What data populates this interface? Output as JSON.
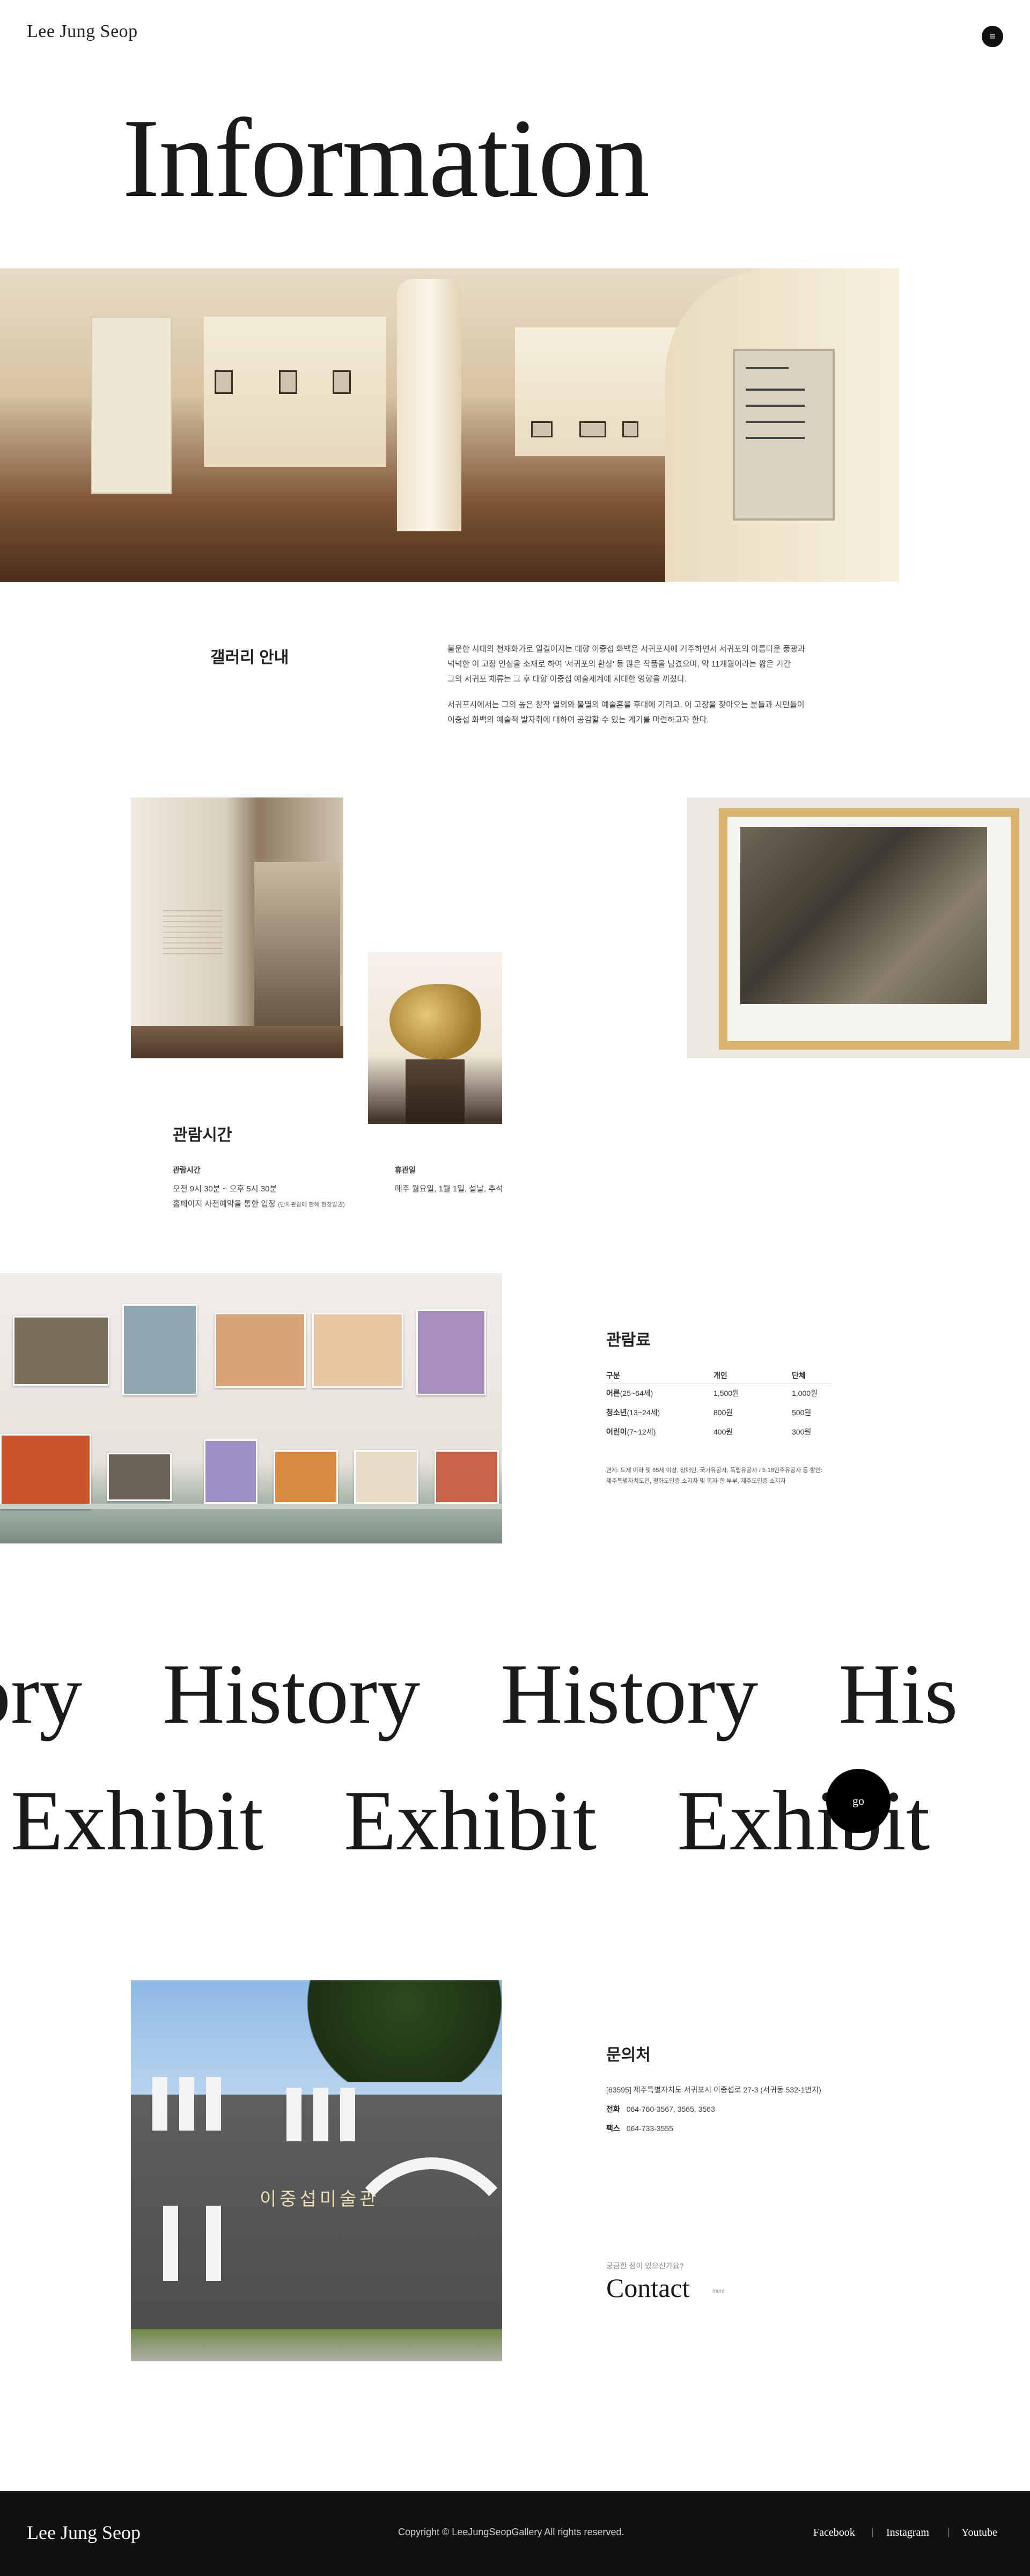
{
  "header": {
    "brand": "Lee Jung Seop",
    "menu_icon": "menu-icon"
  },
  "page": {
    "title": "Information"
  },
  "gallery": {
    "heading": "갤러리 안내",
    "paragraphs": [
      "불운한 시대의 천재화가로 일컬어지는 대향 이중섭 화백은 서귀포시에 거주하면서 서귀포의 아름다운 풍광과",
      "넉넉한 이 고장 인심을 소재로 하여 '서귀포의 환상' 등 많은 작품을 남겼으며, 약 11개월이라는 짧은 기간",
      "그의 서귀포 체류는 그 후 대향 이중섭 예술세계에 지대한 영향을 끼쳤다.",
      "서귀포시에서는 그의 높은 창작 열의와 불멸의 예술혼을 후대에 기리고, 이 고장을 찾아오는 분들과 시민들이",
      "이중섭 화백의 예술적 발자취에 대하여 공감할 수 있는 계기를 마련하고자 한다."
    ]
  },
  "hours": {
    "heading": "관람시간",
    "open_label": "관람시간",
    "open_value": "오전 9시 30분 ~ 오후 5시 30분",
    "reservation": "홈페이지 사전예약을 통한 입장",
    "reservation_note": "(단체관람에 한해 현장발권)",
    "closed_label": "휴관일",
    "closed_value": "매주 월요일, 1월 1일, 설날, 추석"
  },
  "fees": {
    "heading": "관람료",
    "columns": [
      "구분",
      "개인",
      "단체"
    ],
    "rows": [
      {
        "cat": "어른",
        "range": "(25~64세)",
        "individual": "1,500원",
        "group": "1,000원"
      },
      {
        "cat": "청소년",
        "range": "(13~24세)",
        "individual": "800원",
        "group": "500원"
      },
      {
        "cat": "어린이",
        "range": "(7~12세)",
        "individual": "400원",
        "group": "300원"
      }
    ],
    "note": "면제: 도제 이하 및 65세 이상, 장애인, 국가유공자, 독립유공자 / 5·18민주유공자 등 할인: 제주특별자치도민, 평화도민증 소지자 및 독자·한 부부, 제주도민증 소지자"
  },
  "marquee": {
    "row1": [
      "ory",
      "History",
      "History",
      "His"
    ],
    "row2": [
      "Exhibit",
      "Exhibit",
      "Exhibit"
    ],
    "go": "go"
  },
  "contact": {
    "heading": "문의처",
    "address": "[63595] 제주특별자치도 서귀포시 이중섭로 27-3 (서귀동 532-1번지)",
    "phone_label": "전화",
    "phone": "064-760-3567, 3565, 3563",
    "fax_label": "팩스",
    "fax": "064-733-3555",
    "hint": "궁금한 점이 있으신가요?",
    "link": "Contact",
    "link_small": "more"
  },
  "museum_sign": "이중섭미술관",
  "footer": {
    "brand": "Lee Jung Seop",
    "copyright": "Copyright © LeeJungSeopGallery All rights reserved.",
    "links": [
      "Facebook",
      "Instagram",
      "Youtube"
    ]
  }
}
